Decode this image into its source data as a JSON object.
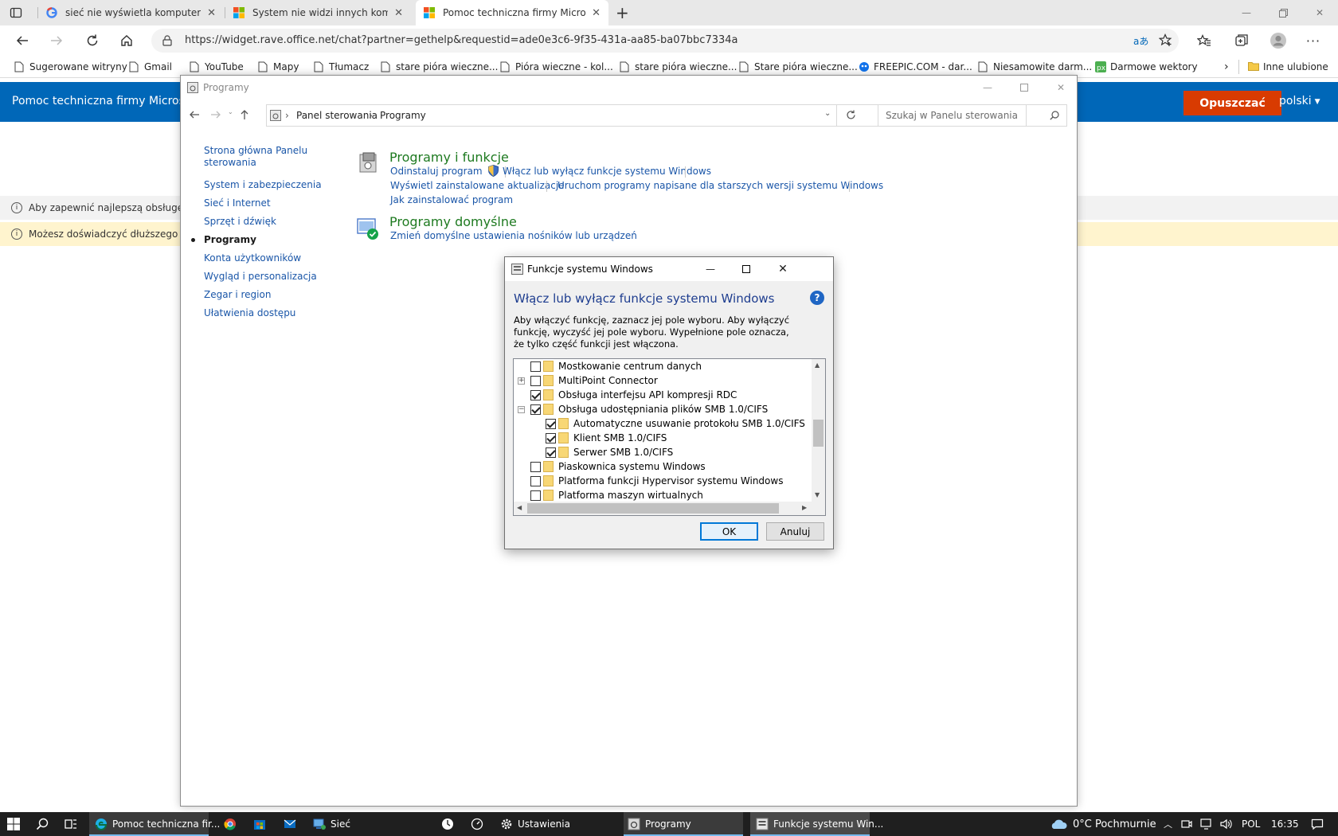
{
  "browser": {
    "tabs": [
      {
        "label": "sieć nie wyświetla komputerów -",
        "favicon": "google-icon"
      },
      {
        "label": "System nie widzi innych kompute",
        "favicon": "microsoft-icon"
      },
      {
        "label": "Pomoc techniczna firmy Microsof",
        "favicon": "microsoft-icon"
      }
    ],
    "url": "https://widget.rave.office.net/chat?partner=gethelp&requestid=ade0e3c6-9f35-431a-aa85-ba07bbc7334a",
    "bookmarks": [
      "Sugerowane witryny",
      "Gmail",
      "YouTube",
      "Mapy",
      "Tłumacz",
      "stare pióra wieczne...",
      "Pióra wieczne - kol...",
      "stare pióra wieczne...",
      "Stare pióra wieczne...",
      "FREEPIC.COM - dar...",
      "Niesamowite darm...",
      "Darmowe wektory"
    ],
    "other_bookmarks": "Inne ulubione"
  },
  "page": {
    "header_title": "Pomoc techniczna firmy Microsoft",
    "exit_button": "Opuszczać",
    "language": "polski",
    "notice1": "Aby zapewnić najlepszą obsługę, po",
    "notice2": "Możesz doświadczyć dłuższego czas"
  },
  "control_panel": {
    "title": "Programy",
    "breadcrumb": [
      "Panel sterowania",
      "Programy"
    ],
    "search_placeholder": "Szukaj w Panelu sterowania",
    "sidebar": [
      "Strona główna Panelu sterowania",
      "System i zabezpieczenia",
      "Sieć i Internet",
      "Sprzęt i dźwięk",
      "Programy",
      "Konta użytkowników",
      "Wygląd i personalizacja",
      "Zegar i region",
      "Ułatwienia dostępu"
    ],
    "selected_sidebar": "Programy",
    "section1": {
      "title": "Programy i funkcje",
      "links": [
        "Odinstaluj program",
        "Włącz lub wyłącz funkcje systemu Windows",
        "Wyświetl zainstalowane aktualizacje",
        "Uruchom programy napisane dla starszych wersji systemu Windows",
        "Jak zainstalować program"
      ]
    },
    "section2": {
      "title": "Programy domyślne",
      "links": [
        "Zmień domyślne ustawienia nośników lub urządzeń"
      ]
    }
  },
  "dialog": {
    "title": "Funkcje systemu Windows",
    "heading": "Włącz lub wyłącz funkcje systemu Windows",
    "description": "Aby włączyć funkcję, zaznacz jej pole wyboru. Aby wyłączyć funkcję, wyczyść jej pole wyboru. Wypełnione pole oznacza, że tylko część funkcji jest włączona.",
    "features": [
      {
        "label": "Mostkowanie centrum danych",
        "checked": false,
        "expander": "",
        "indent": 0
      },
      {
        "label": "MultiPoint Connector",
        "checked": false,
        "expander": "+",
        "indent": 0
      },
      {
        "label": "Obsługa interfejsu API kompresji RDC",
        "checked": true,
        "expander": "",
        "indent": 0
      },
      {
        "label": "Obsługa udostępniania plików SMB 1.0/CIFS",
        "checked": true,
        "expander": "−",
        "indent": 0
      },
      {
        "label": "Automatyczne usuwanie protokołu SMB 1.0/CIFS",
        "checked": true,
        "expander": "",
        "indent": 1
      },
      {
        "label": "Klient SMB 1.0/CIFS",
        "checked": true,
        "expander": "",
        "indent": 1
      },
      {
        "label": "Serwer SMB 1.0/CIFS",
        "checked": true,
        "expander": "",
        "indent": 1
      },
      {
        "label": "Piaskownica systemu Windows",
        "checked": false,
        "expander": "",
        "indent": 0
      },
      {
        "label": "Platforma funkcji Hypervisor systemu Windows",
        "checked": false,
        "expander": "",
        "indent": 0
      },
      {
        "label": "Platforma maszyn wirtualnych",
        "checked": false,
        "expander": "",
        "indent": 0
      }
    ],
    "ok": "OK",
    "cancel": "Anuluj"
  },
  "taskbar": {
    "apps": [
      {
        "label": "Pomoc techniczna fir...",
        "icon": "edge-icon"
      },
      {
        "label": "Sieć",
        "icon": "network-icon"
      },
      {
        "label": "Ustawienia",
        "icon": "gear-icon"
      },
      {
        "label": "Programy",
        "icon": "control-panel-icon"
      },
      {
        "label": "Funkcje systemu Win...",
        "icon": "features-icon"
      }
    ],
    "weather": "0°C  Pochmurnie",
    "language": "POL",
    "time": "16:35"
  }
}
